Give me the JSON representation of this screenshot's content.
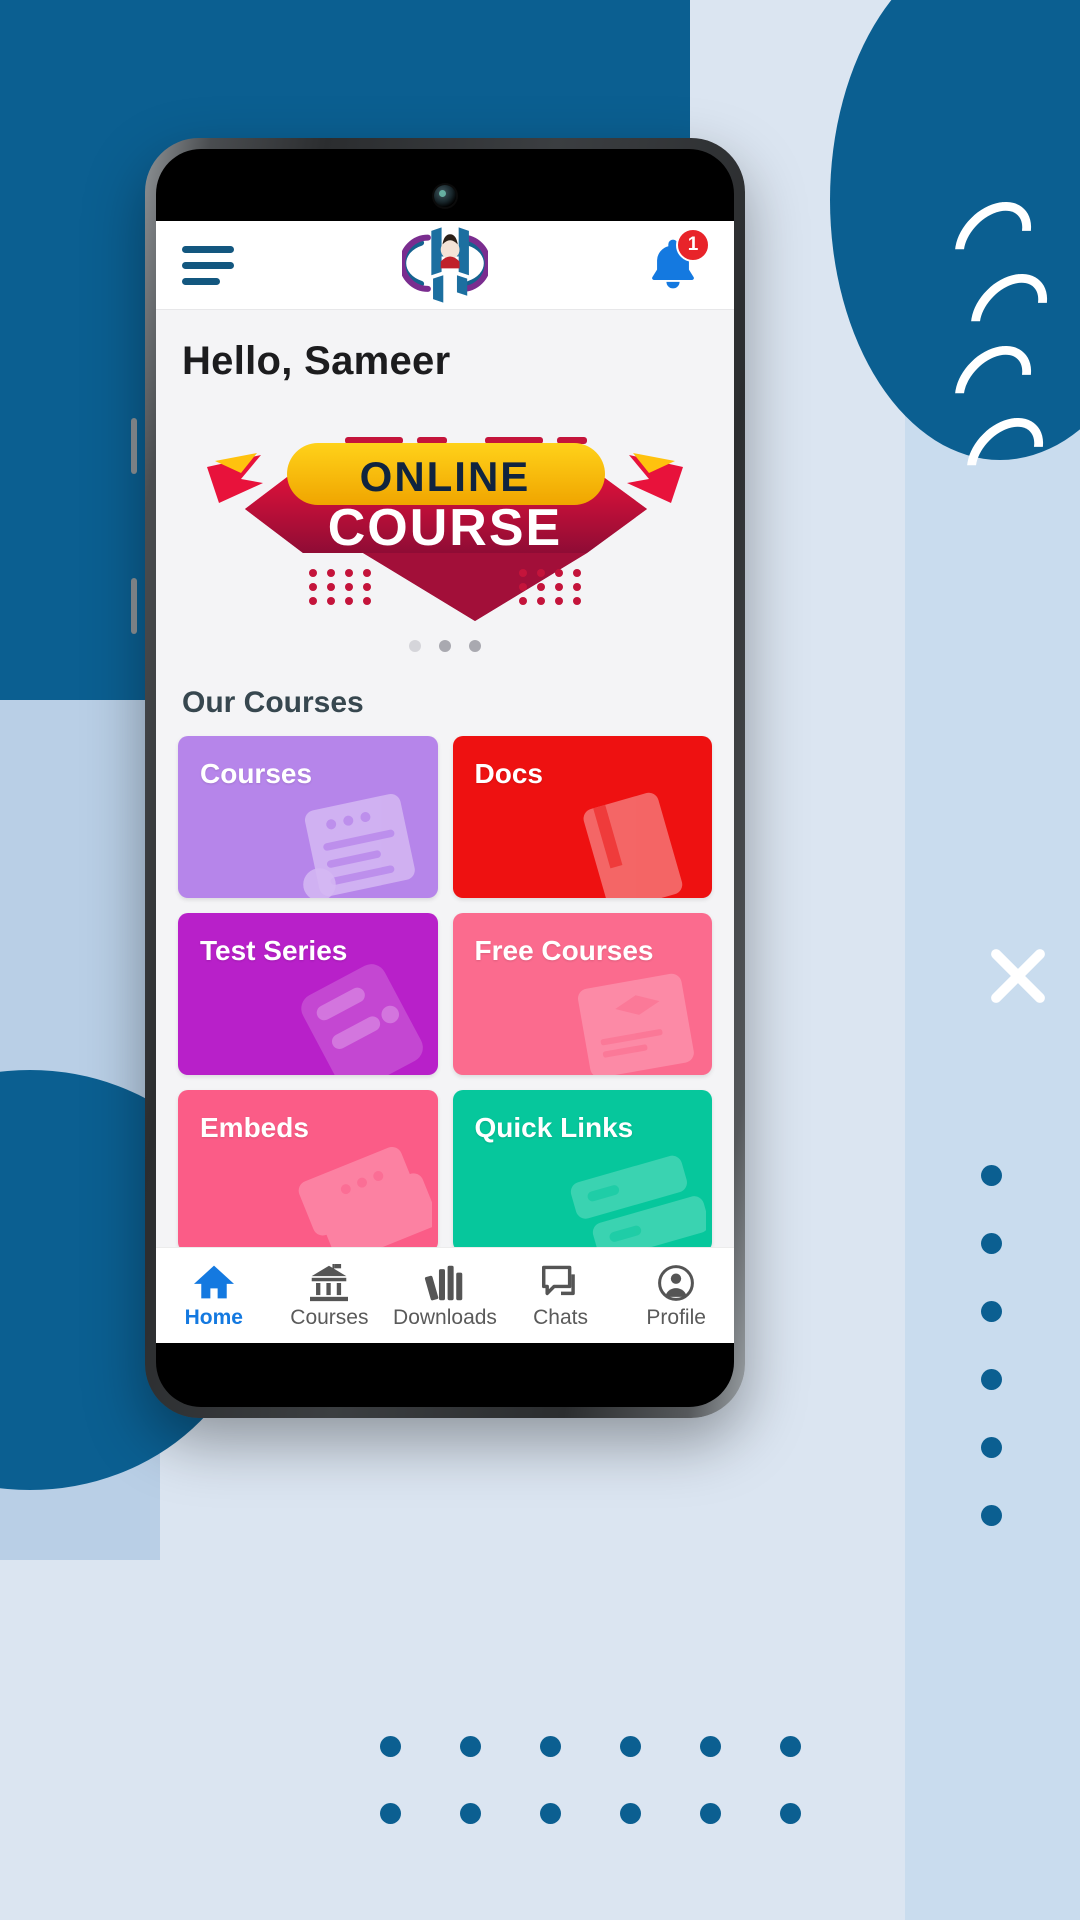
{
  "app": {
    "header": {
      "menu_icon": "hamburger-menu-icon",
      "logo_alt": "app-logo",
      "notification_icon": "bell-icon",
      "notification_count": "1"
    },
    "greeting": "Hello, Sameer",
    "banner": {
      "line1": "ONLINE",
      "line2": "COURSE",
      "pager_dots": 3,
      "active_dot_index": 1
    },
    "section": {
      "title": "Our Courses"
    },
    "tiles": [
      {
        "label": "Courses",
        "color": "#b685ea",
        "art": "document-art-icon"
      },
      {
        "label": "Docs",
        "color": "#ee1111",
        "art": "book-art-icon"
      },
      {
        "label": "Test Series",
        "color": "#b820c9",
        "art": "clipboard-art-icon"
      },
      {
        "label": "Free Courses",
        "color": "#fb6b8e",
        "art": "certificate-art-icon"
      },
      {
        "label": "Embeds",
        "color": "#fb5c87",
        "art": "card-art-icon"
      },
      {
        "label": "Quick Links",
        "color": "#06c79c",
        "art": "links-art-icon"
      }
    ],
    "bottom_nav": [
      {
        "label": "Home",
        "icon": "home-icon",
        "active": true
      },
      {
        "label": "Courses",
        "icon": "bank-icon",
        "active": false
      },
      {
        "label": "Downloads",
        "icon": "books-icon",
        "active": false
      },
      {
        "label": "Chats",
        "icon": "chat-icon",
        "active": false
      },
      {
        "label": "Profile",
        "icon": "profile-icon",
        "active": false
      }
    ]
  },
  "theme": {
    "brand_blue": "#0b5f91",
    "accent_blue": "#1479e0",
    "badge_red": "#e8242a",
    "screen_bg": "#f4f4f6"
  }
}
